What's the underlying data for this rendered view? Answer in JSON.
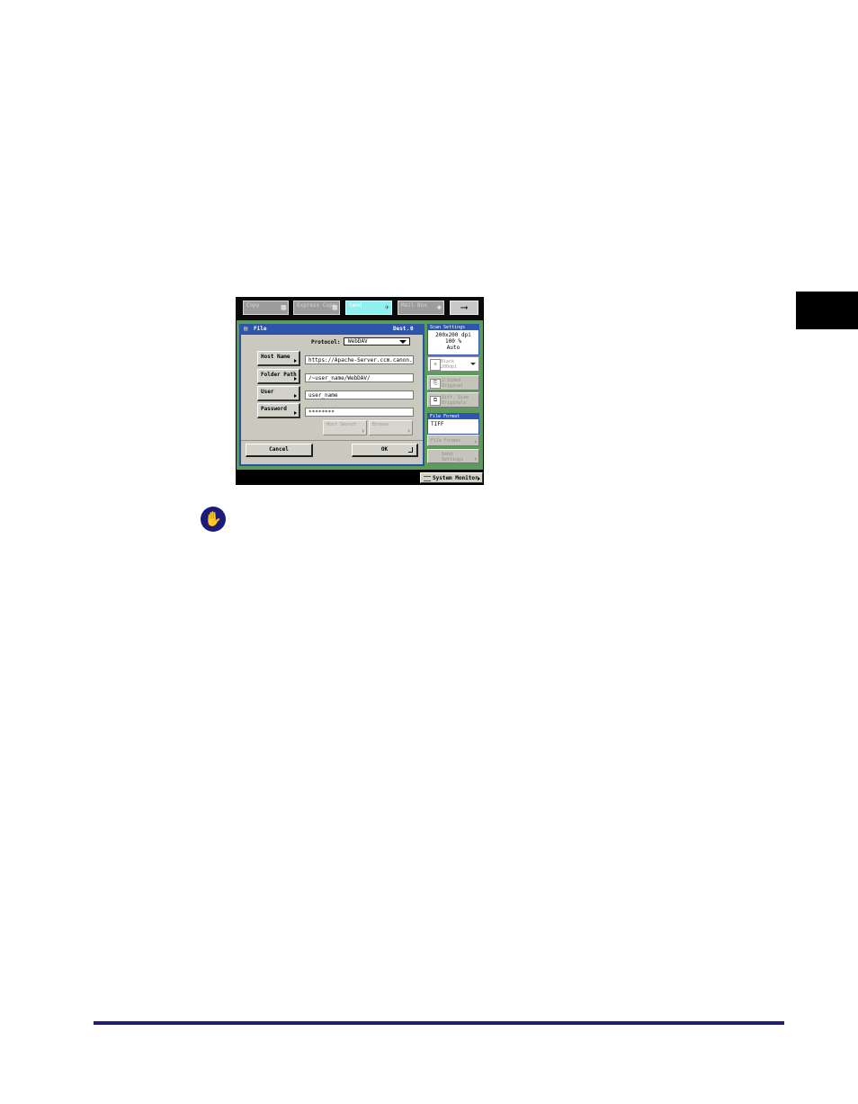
{
  "tabs": [
    {
      "label": "Copy",
      "icon": "copy-icon"
    },
    {
      "label": "Express Copy",
      "icon": "express-copy-icon"
    },
    {
      "label": "Send",
      "icon": "paper-plane-icon"
    },
    {
      "label": "Mail Box",
      "icon": "mailbox-icon"
    }
  ],
  "dialog": {
    "title": "File",
    "dest_label": "Dest.",
    "dest_count": "0",
    "protocol_label": "Protocol:",
    "protocol_value": "WebDAV",
    "fields": [
      {
        "label": "Host Name",
        "value": "https://Apache-Server.ccm.canon."
      },
      {
        "label": "Folder Path",
        "value": "/~user_name/WebDAV/"
      },
      {
        "label": "User",
        "value": "user_name"
      },
      {
        "label": "Password",
        "value": "********"
      }
    ],
    "host_search_label": "Host Search",
    "browse_label": "Browse",
    "cancel_label": "Cancel",
    "ok_label": "OK"
  },
  "side": {
    "scan_settings_header": "Scan Settings",
    "resolution": "200x200 dpi",
    "zoom": "100 %",
    "density": "Auto",
    "color_mode_line1": "Black",
    "color_mode_line2": "200dpi",
    "two_sided_line1": "2-Sided",
    "two_sided_line2": "Original",
    "diff_size_line1": "Diff. Size",
    "diff_size_line2": "Originals",
    "file_format_header": "File Format",
    "file_format_value": "TIFF",
    "file_format_btn": "File Format",
    "send_settings_line1": "Send",
    "send_settings_line2": "Settings"
  },
  "status": {
    "system_monitor_label": "System Monitor"
  },
  "colors": {
    "panel_green": "#5b9c5b",
    "dialog_blue": "#2950a7",
    "active_tab": "#8ef0f0",
    "note_icon": "#1b1b7a",
    "footer_rule": "#1f1f6e"
  }
}
